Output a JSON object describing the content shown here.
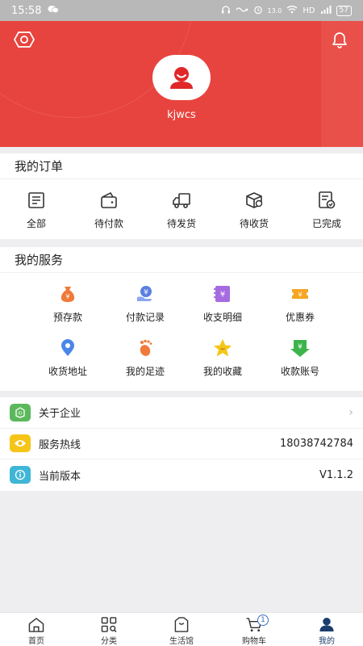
{
  "status_bar": {
    "time": "15:58",
    "network_speed": "13.0",
    "network_type": "HD",
    "battery": "57"
  },
  "header": {
    "username": "kjwcs",
    "background_color": "#e8443f"
  },
  "orders": {
    "title": "我的订单",
    "items": [
      {
        "label": "全部",
        "icon": "order-list-icon"
      },
      {
        "label": "待付款",
        "icon": "wallet-icon"
      },
      {
        "label": "待发货",
        "icon": "truck-icon"
      },
      {
        "label": "待收货",
        "icon": "package-icon"
      },
      {
        "label": "已完成",
        "icon": "completed-doc-icon"
      }
    ]
  },
  "services": {
    "title": "我的服务",
    "items": [
      {
        "label": "预存款",
        "icon": "money-bag-icon",
        "color": "#f07a3a"
      },
      {
        "label": "付款记录",
        "icon": "payment-record-icon",
        "color": "#5b7fe0"
      },
      {
        "label": "收支明细",
        "icon": "ledger-icon",
        "color": "#a66be0"
      },
      {
        "label": "优惠券",
        "icon": "coupon-icon",
        "color": "#f5a623"
      },
      {
        "label": "收货地址",
        "icon": "location-pin-icon",
        "color": "#4a86e8"
      },
      {
        "label": "我的足迹",
        "icon": "footprint-icon",
        "color": "#f07a3a"
      },
      {
        "label": "我的收藏",
        "icon": "star-icon",
        "color": "#f5c518"
      },
      {
        "label": "收款账号",
        "icon": "receive-account-icon",
        "color": "#3cb44b"
      }
    ]
  },
  "info": {
    "rows": [
      {
        "label": "关于企业",
        "value": "",
        "icon": "enterprise-icon",
        "color": "#5cb85c",
        "has_arrow": true
      },
      {
        "label": "服务热线",
        "value": "18038742784",
        "icon": "hotline-icon",
        "color": "#f5c518",
        "has_arrow": false
      },
      {
        "label": "当前版本",
        "value": "V1.1.2",
        "icon": "version-info-icon",
        "color": "#3fb6d6",
        "has_arrow": false
      }
    ]
  },
  "tabbar": {
    "tabs": [
      {
        "label": "首页",
        "icon": "home-icon"
      },
      {
        "label": "分类",
        "icon": "category-icon"
      },
      {
        "label": "生活馆",
        "icon": "life-hall-icon"
      },
      {
        "label": "购物车",
        "icon": "cart-icon",
        "badge": "1"
      },
      {
        "label": "我的",
        "icon": "profile-icon",
        "active": true
      }
    ]
  }
}
